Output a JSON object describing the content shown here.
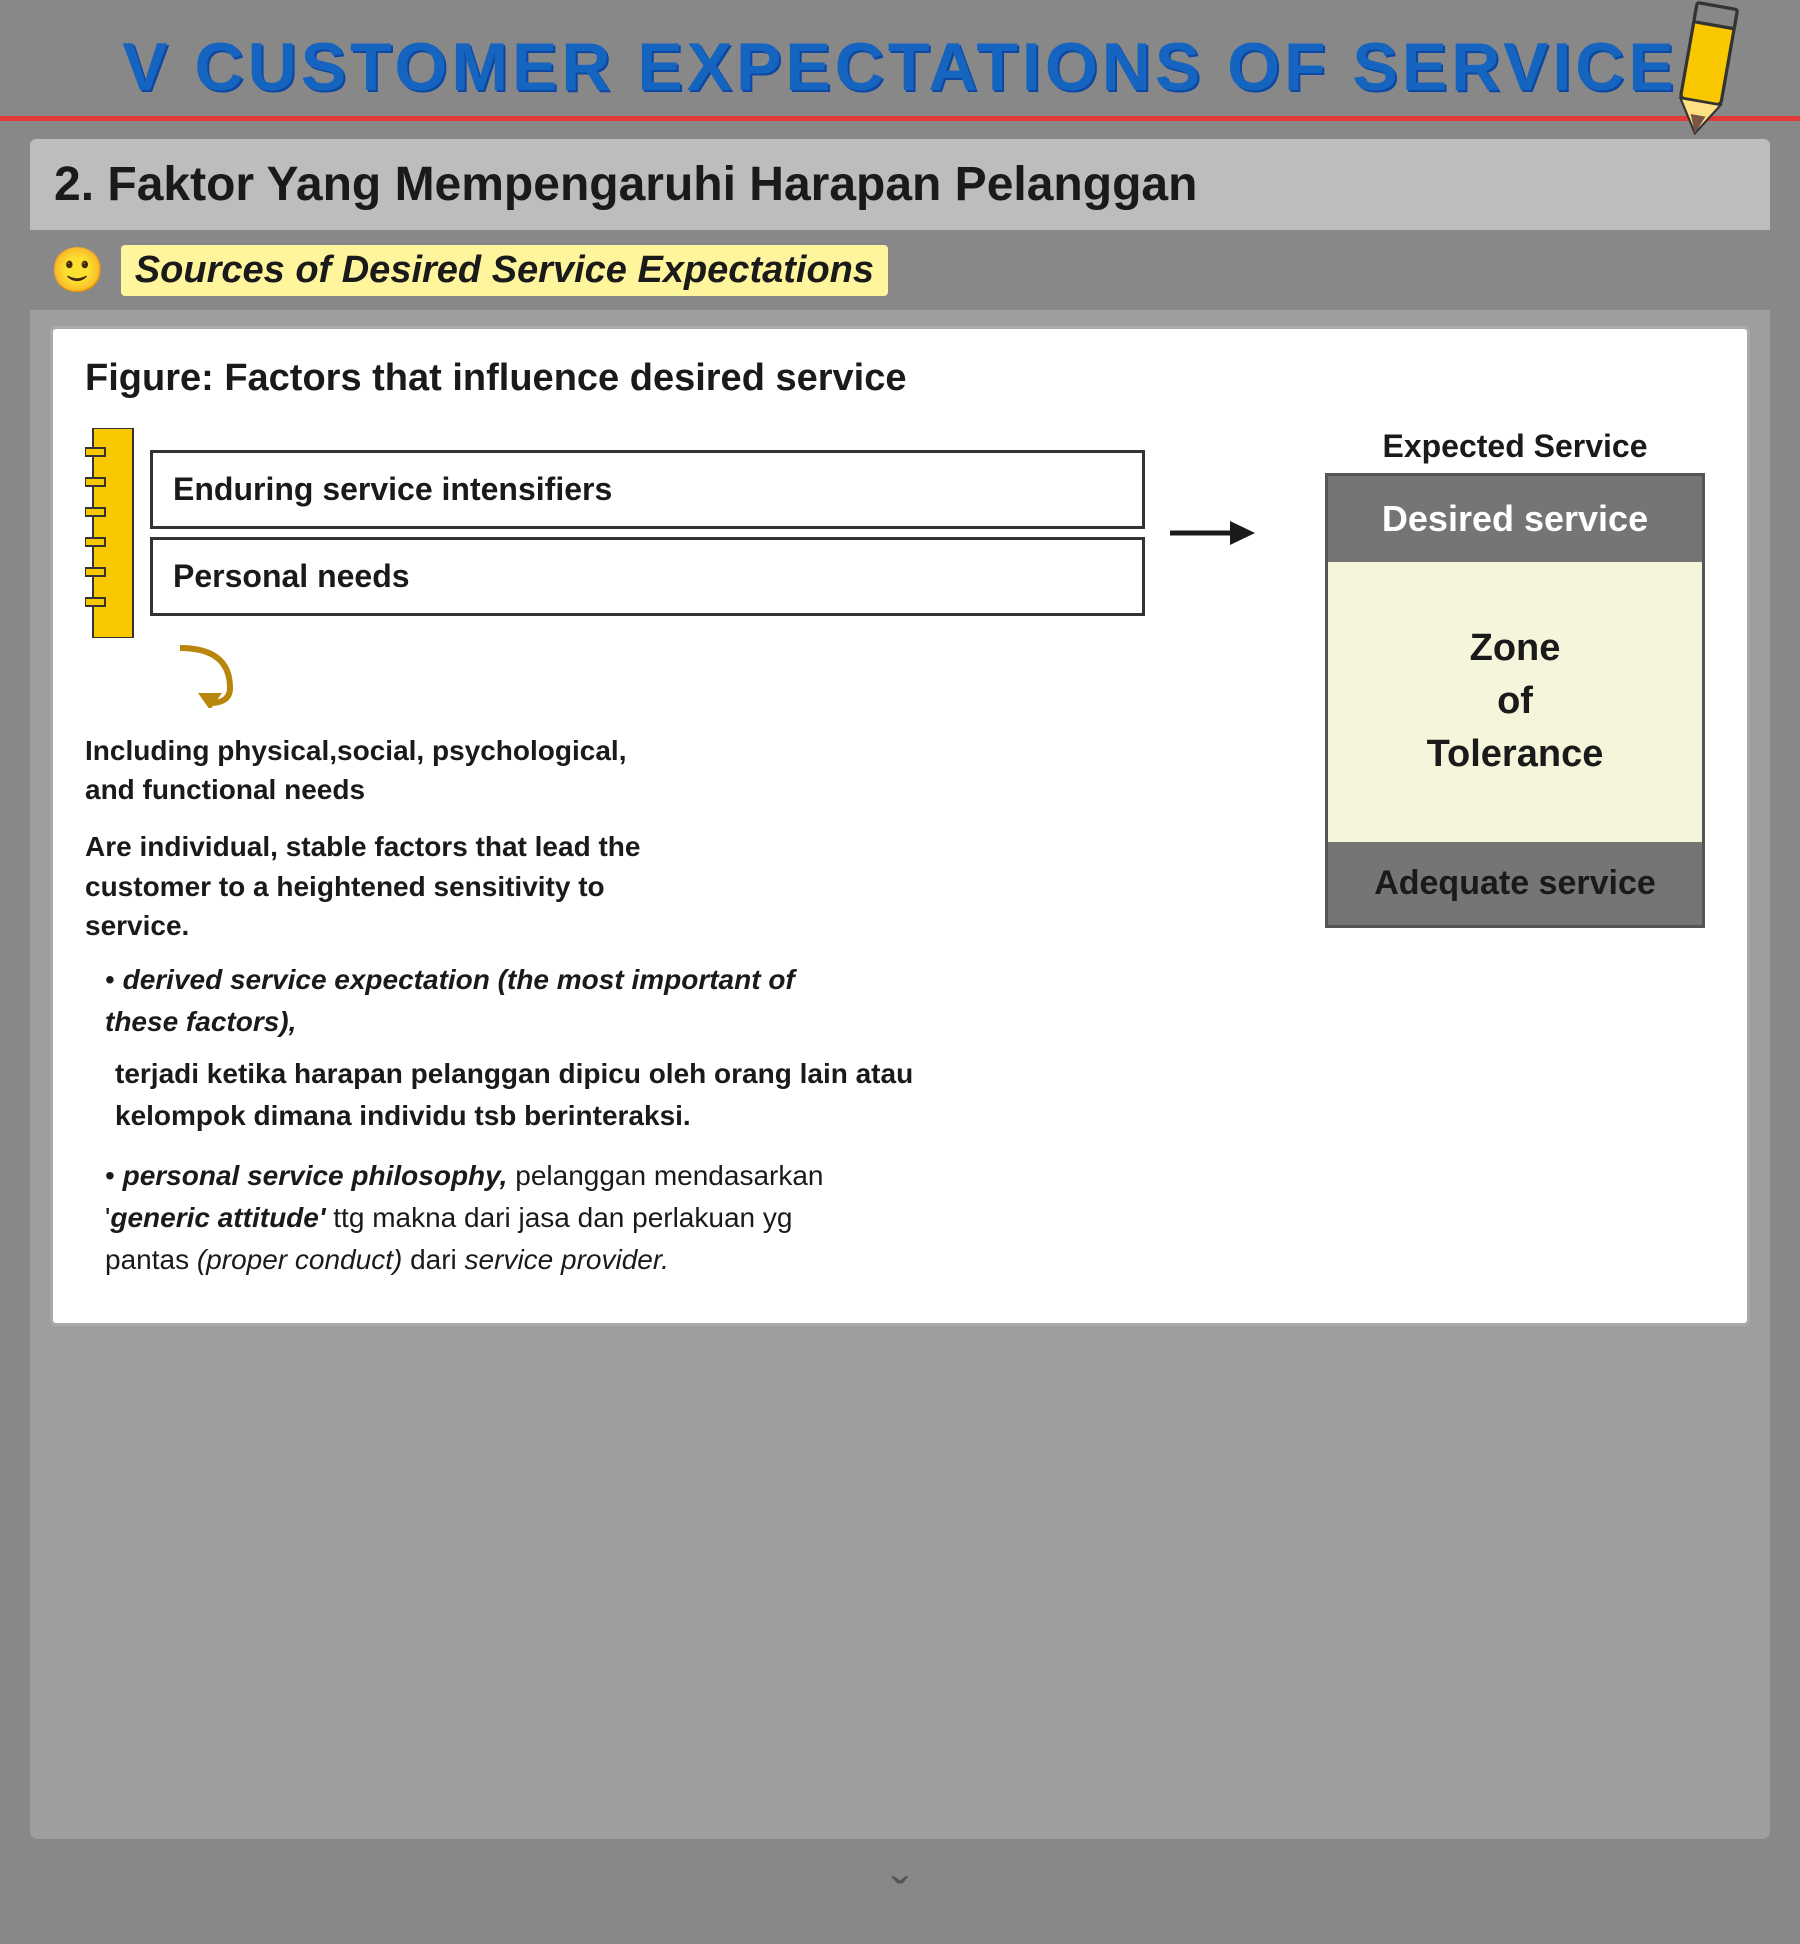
{
  "header": {
    "title": "V    CUSTOMER EXPECTATIONS OF SERVICE"
  },
  "section": {
    "heading": "2. Faktor Yang Mempengaruhi Harapan Pelanggan",
    "sub_heading": "Sources of Desired Service Expectations",
    "figure_title": "Figure: Factors that influence desired service"
  },
  "diagram": {
    "enduring_service": "Enduring service intensifiers",
    "personal_needs": "Personal needs",
    "expected_service_label": "Expected Service",
    "desired_service": "Desired service",
    "zone_tolerance": "Zone\nof\nTolerance",
    "adequate_service": "Adequate service"
  },
  "body_texts": {
    "including_text": "Including physical,social, psychological, and functional needs",
    "are_individual": "Are individual, stable factors that lead the customer to a heightened sensitivity to service.",
    "bullet1_bold": "derived service expectation (the most important of these factors),",
    "bullet1_normal": "terjadi ketika harapan pelanggan dipicu oleh orang lain atau kelompok dimana individu tsb berinteraksi.",
    "bullet2_bold": "personal service philosophy,",
    "bullet2_normal": "pelanggan mendasarkan '’generic attitude’ ttg makna dari jasa dan perlakuan yg pantas (proper conduct) dari service provider."
  }
}
